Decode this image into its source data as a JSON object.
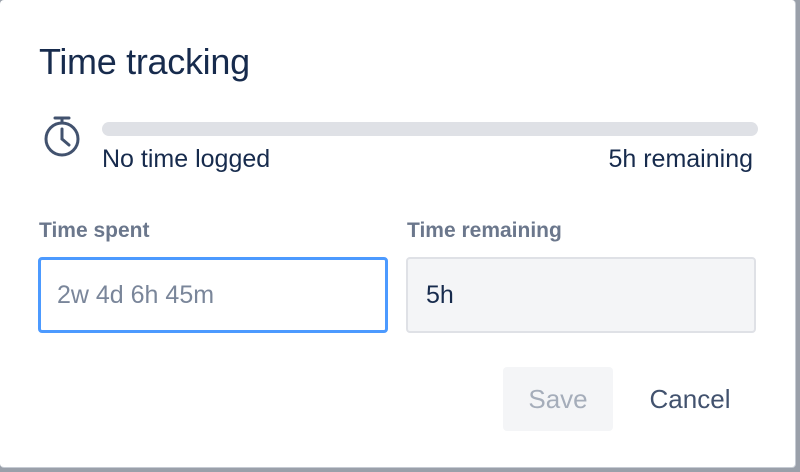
{
  "dialog": {
    "title": "Time tracking"
  },
  "tracking": {
    "icon": "stopwatch-icon",
    "progress_fraction": 0,
    "logged_text": "No time logged",
    "remaining_text": "5h remaining"
  },
  "fields": {
    "time_spent": {
      "label": "Time spent",
      "placeholder": "2w 4d 6h 45m",
      "value": ""
    },
    "time_remaining": {
      "label": "Time remaining",
      "value": "5h"
    }
  },
  "actions": {
    "save_label": "Save",
    "cancel_label": "Cancel"
  },
  "colors": {
    "title": "#172b4d",
    "focus_border": "#4c9aff",
    "track": "#dfe1e6",
    "muted_label": "#6b778c",
    "disabled_button_text": "#a5adba"
  }
}
